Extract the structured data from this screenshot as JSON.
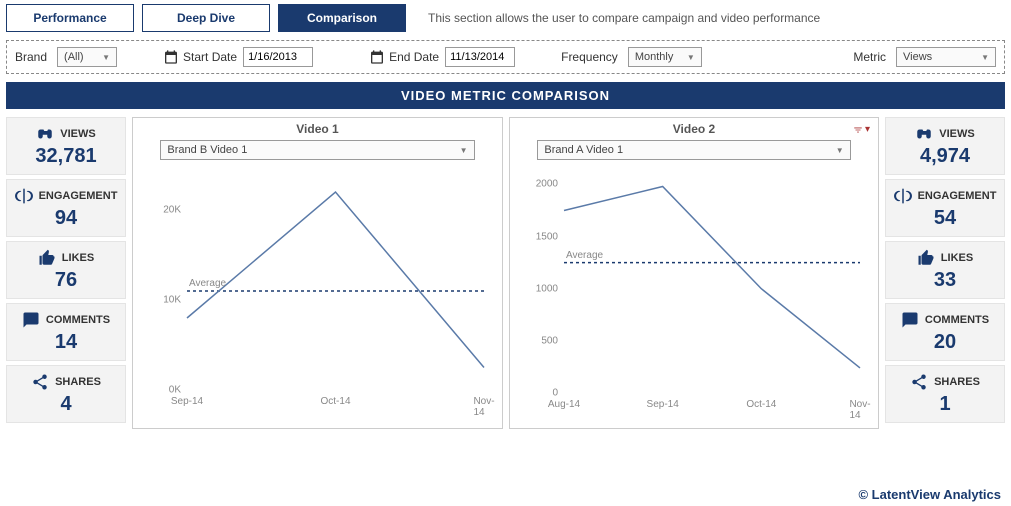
{
  "tabs": {
    "performance": "Performance",
    "deepdive": "Deep Dive",
    "comparison": "Comparison"
  },
  "desc": "This section allows the user to compare campaign and video performance",
  "filters": {
    "brand_label": "Brand",
    "brand_value": "(All)",
    "start_label": "Start Date",
    "start_value": "1/16/2013",
    "end_label": "End Date",
    "end_value": "11/13/2014",
    "freq_label": "Frequency",
    "freq_value": "Monthly",
    "metric_label": "Metric",
    "metric_value": "Views"
  },
  "band_title": "VIDEO METRIC COMPARISON",
  "left_metrics": {
    "views_label": "VIEWS",
    "views_value": "32,781",
    "eng_label": "ENGAGEMENT",
    "eng_value": "94",
    "likes_label": "LIKES",
    "likes_value": "76",
    "comments_label": "COMMENTS",
    "comments_value": "14",
    "shares_label": "SHARES",
    "shares_value": "4"
  },
  "right_metrics": {
    "views_label": "VIEWS",
    "views_value": "4,974",
    "eng_label": "ENGAGEMENT",
    "eng_value": "54",
    "likes_label": "LIKES",
    "likes_value": "33",
    "comments_label": "COMMENTS",
    "comments_value": "20",
    "shares_label": "SHARES",
    "shares_value": "1"
  },
  "video1": {
    "title": "Video 1",
    "select_value": "Brand B Video 1",
    "avg_label": "Average"
  },
  "video2": {
    "title": "Video 2",
    "select_value": "Brand A Video 1",
    "avg_label": "Average"
  },
  "footer": "© LatentView Analytics",
  "chart_data": [
    {
      "type": "line",
      "title": "Video 1",
      "series_name": "Brand B Video 1",
      "categories": [
        "Sep-14",
        "Oct-14",
        "Nov-14"
      ],
      "values": [
        8000,
        22000,
        2500
      ],
      "average_line": 11000,
      "yticks": [
        0,
        10000,
        20000
      ],
      "ytick_labels": [
        "0K",
        "10K",
        "20K"
      ],
      "ylim": [
        0,
        24000
      ],
      "xlabel": "",
      "ylabel": ""
    },
    {
      "type": "line",
      "title": "Video 2",
      "series_name": "Brand A Video 1",
      "categories": [
        "Aug-14",
        "Sep-14",
        "Oct-14",
        "Nov-14"
      ],
      "values": [
        1750,
        1980,
        1000,
        240
      ],
      "average_line": 1250,
      "yticks": [
        0,
        500,
        1000,
        1500,
        2000
      ],
      "ytick_labels": [
        "0",
        "500",
        "1000",
        "1500",
        "2000"
      ],
      "ylim": [
        0,
        2100
      ],
      "xlabel": "",
      "ylabel": ""
    }
  ]
}
